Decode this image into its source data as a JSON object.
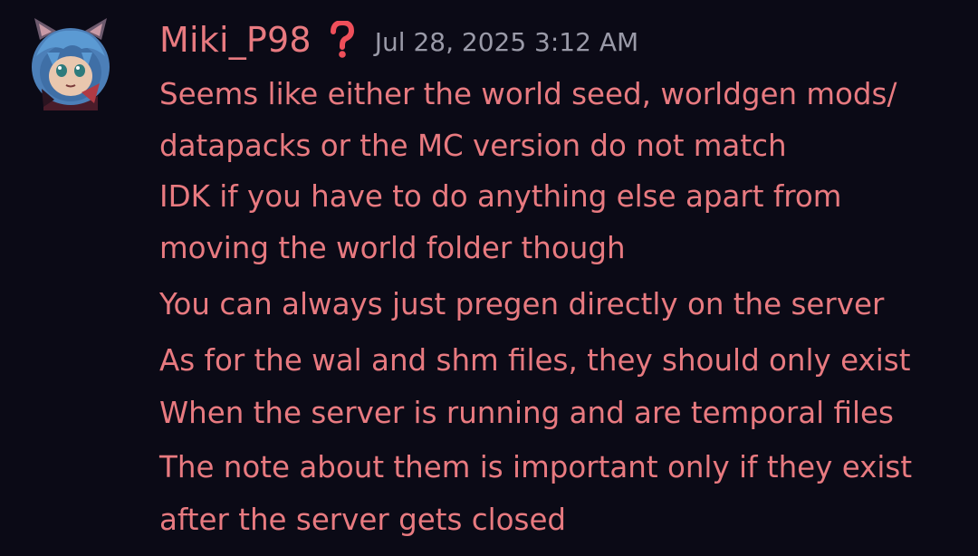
{
  "message": {
    "author": "Miki_P98",
    "timestamp": "Jul 28, 2025 3:12 AM",
    "role_icon": "question-mark-icon",
    "colors": {
      "background": "#0b0a16",
      "text": "#e87a80",
      "username": "#e87a80",
      "timestamp": "#9a9aa8",
      "role_icon": "#ef4f5a"
    },
    "lines": [
      "Seems like either the world seed, worldgen mods/",
      "datapacks or the MC version do not match",
      "IDK if you have to do anything else apart from",
      "moving the world folder though",
      "You can always just pregen directly on the server",
      "As for the wal and shm files, they should only exist",
      "When the server is running and are temporal files",
      "The note about them is important only if they exist",
      "after the server gets closed"
    ]
  }
}
